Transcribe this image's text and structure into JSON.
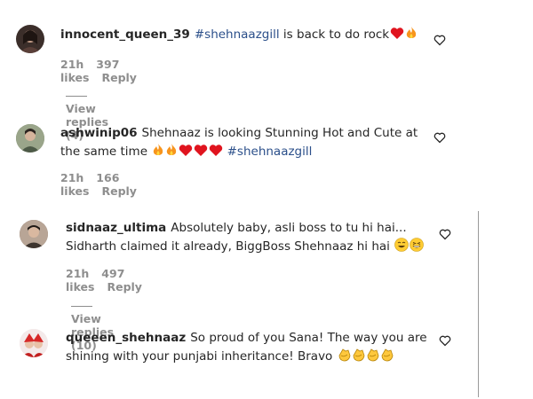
{
  "comments": [
    {
      "username": "innocent_queen_39",
      "text": "",
      "hashtag": "#shehnaazgill",
      "text_after": "is back to do rock",
      "time": "21h",
      "likes": "397 likes",
      "reply": "Reply",
      "view_replies": "View replies (4)",
      "emojis": [
        "heart",
        "fire"
      ]
    },
    {
      "username": "ashwinip06",
      "text": "Shehnaaz is looking Stunning Hot and Cute at the same time",
      "hashtag": "#shehnaazgill",
      "text_after": "",
      "time": "21h",
      "likes": "166 likes",
      "reply": "Reply",
      "emojis": [
        "fire",
        "fire",
        "heart",
        "heart",
        "heart"
      ]
    },
    {
      "username": "sidnaaz_ultima",
      "text": "Absolutely baby, asli boss to tu hi hai... Sidharth claimed it already, BiggBoss Shehnaaz hi hai",
      "hashtag": "",
      "text_after": "",
      "time": "21h",
      "likes": "497 likes",
      "reply": "Reply",
      "view_replies": "View replies (10)",
      "emojis": [
        "grin",
        "laugh"
      ]
    },
    {
      "username": "queeen_shehnaaz",
      "text": "So proud of you Sana! The way you are shining with your punjabi inheritance! Bravo",
      "hashtag": "",
      "text_after": "",
      "emojis": [
        "clap",
        "clap",
        "clap",
        "clap"
      ]
    }
  ],
  "colors": {
    "hashtag": "#2b4f8a",
    "meta": "#8e8e8e"
  },
  "icons": {
    "like": "heart-outline-icon"
  }
}
